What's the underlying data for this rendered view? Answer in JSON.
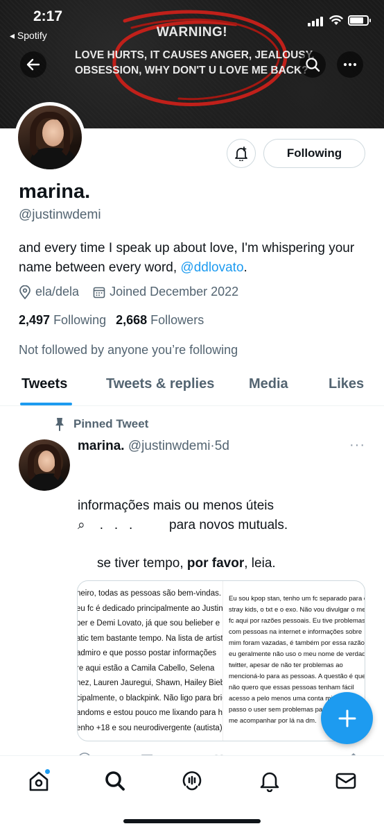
{
  "status_bar": {
    "time": "2:17",
    "back_app": "◂ Spotify",
    "battery_level": 0.8
  },
  "banner": {
    "warning": "WARNING!",
    "line1": "LOVE HURTS, IT CAUSES ANGER, JEALOUSY,",
    "line2": "OBSESSION, WHY DON'T U LOVE ME BACK?"
  },
  "profile": {
    "display_name": "marina.",
    "handle": "@justinwdemi",
    "bio_text": "and every time I speak up about love, I'm whispering your name between every word, ",
    "bio_mention": "@ddlovato",
    "bio_end": ".",
    "pronouns": "ela/dela",
    "joined": "Joined December 2022",
    "following_count": "2,497",
    "following_label": "Following",
    "followers_count": "2,668",
    "followers_label": "Followers",
    "not_followed_text": "Not followed by anyone you’re following",
    "following_button": "Following"
  },
  "tabs": [
    {
      "label": "Tweets",
      "active": true
    },
    {
      "label": "Tweets & replies",
      "active": false
    },
    {
      "label": "Media",
      "active": false
    },
    {
      "label": "Likes",
      "active": false
    }
  ],
  "pinned_tweet": {
    "pinned_label": "Pinned Tweet",
    "name": "marina.",
    "handle": "@justinwdemi",
    "separator": "·",
    "age": "5d",
    "more": "···",
    "line1": "informações mais ou menos úteis",
    "line2": "⌕    .   .   .          para novos mutuals.",
    "line3_a": "se tiver tempo, ",
    "line3_b": "por favor",
    "line3_c": ", leia.",
    "media_left": [
      "neiro, todas as pessoas são bem-vindas.",
      "eu fc é dedicado principalmente ao Justin",
      "ber e Demi Lovato, já que sou belieber e",
      "atic tem bastante tempo. Na lista de artista",
      "admiro e que posso postar informações",
      "re aqui estão a Camila Cabello, Selena",
      "nez, Lauren Jauregui, Shawn, Hailey Bieber",
      "cipalmente, o blackpink. Não ligo para brig",
      "andoms e estou pouco me lixando para ha",
      "enho +18 e sou neurodivergente (autista)."
    ],
    "media_right": [
      "Eu sou kpop stan, tenho um fc separado para o",
      "stray kids, o txt e o exo. Não vou divulgar o meu",
      "fc aqui por razões pessoais. Eu tive problemas",
      "com pessoas na internet e informações sobre",
      "mim foram vazadas, é também por essa razão que",
      "eu geralmente não uso o meu nome de verdade ne",
      "twitter, apesar de não ter problemas ao",
      "mencioná-lo para as pessoas. A questão é que eu",
      "não quero que essas pessoas tenham fácil",
      "acesso a pelo menos uma conta minha",
      "passo o user sem problemas para q",
      "me acompanhar por lá na dm."
    ]
  },
  "fab": {
    "icon": "plus-icon"
  },
  "bottom_nav": [
    {
      "name": "home",
      "icon": "home-icon",
      "notification": true
    },
    {
      "name": "search",
      "icon": "search-icon"
    },
    {
      "name": "spaces",
      "icon": "spaces-icon"
    },
    {
      "name": "notifications",
      "icon": "bell-icon"
    },
    {
      "name": "messages",
      "icon": "mail-icon"
    }
  ],
  "colors": {
    "accent": "#1d9bf0",
    "text": "#0f1419",
    "secondary": "#536471",
    "border": "#cfd9de"
  }
}
